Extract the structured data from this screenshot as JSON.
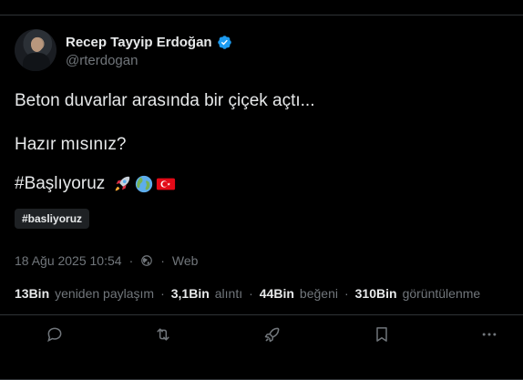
{
  "author": {
    "display_name": "Recep Tayyip Erdoğan",
    "handle": "@rterdogan",
    "verified": true
  },
  "tweet": {
    "line1": "Beton duvarlar arasında bir çiçek açtı...",
    "line2": "Hazır mısınız?",
    "line3_text": "#Başlıyoruz",
    "line3_emojis": [
      "rocket-emoji",
      "globe-emoji",
      "turkey-flag-emoji"
    ],
    "hashtag_chip": "#basliyoruz"
  },
  "meta": {
    "timestamp": "18 Ağu 2025 10:54",
    "source": "Web"
  },
  "stats": {
    "retweets_num": "13Bin",
    "retweets_label": "yeniden paylaşım",
    "quotes_num": "3,1Bin",
    "quotes_label": "alıntı",
    "likes_num": "44Bin",
    "likes_label": "beğeni",
    "views_num": "310Bin",
    "views_label": "görüntülenme"
  },
  "actions": [
    "reply-icon",
    "retweet-icon",
    "boost-icon",
    "bookmark-icon",
    "more-icon"
  ],
  "colors": {
    "background": "#000000",
    "text": "#e7e9ea",
    "muted": "#71767b",
    "verified": "#1d9bf0",
    "border": "#2f3336"
  }
}
